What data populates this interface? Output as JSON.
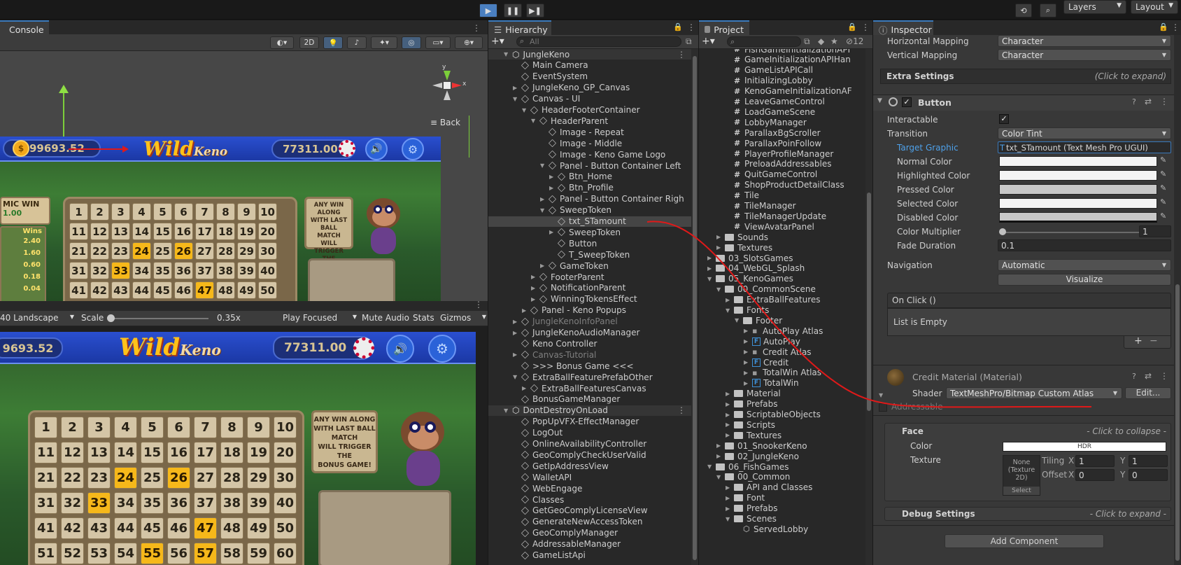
{
  "toolbar_top": {
    "layers_label": "Layers",
    "layout_label": "Layout"
  },
  "console": {
    "tab_label": "Console"
  },
  "scene": {
    "mode_2d": "2D",
    "back_label": "Back",
    "gizmo_axis_x": "x",
    "gizmo_axis_y": "y"
  },
  "game_toolbar": {
    "aspect": "40 Landscape",
    "scale_label": "Scale",
    "scale_value": "0.35x",
    "play_focused": "Play Focused",
    "mute_audio": "Mute Audio",
    "stats": "Stats",
    "gizmos": "Gizmos"
  },
  "game": {
    "balance_top": "99693.52",
    "balance_bottom": "9693.52",
    "credits": "77311.00",
    "logo_main": "Wild",
    "logo_sub": "Keno",
    "cosmic_win_label": "MIC WIN",
    "cosmic_win_value": "1.00",
    "wins_label": "Wins",
    "wins_values": [
      "2.40",
      "1.60",
      "0.60",
      "0.18",
      "0.04"
    ],
    "bonus_note": [
      "ANY WIN ALONG",
      "WITH LAST BALL",
      "MATCH",
      "WILL TRIGGER",
      "THE",
      "BONUS GAME!"
    ],
    "hit_numbers": [
      24,
      26,
      33,
      47,
      55,
      57
    ]
  },
  "hierarchy": {
    "tab_label": "Hierarchy",
    "search_placeholder": "All",
    "rows": [
      {
        "label": "JungleKeno",
        "indent": 0,
        "tri": "▼",
        "icon": "unity",
        "kebab": true,
        "dim": false,
        "sel": false
      },
      {
        "label": "Main Camera",
        "indent": 1,
        "tri": "",
        "icon": "cube",
        "dim": false,
        "sel": false
      },
      {
        "label": "EventSystem",
        "indent": 1,
        "tri": "",
        "icon": "cube",
        "dim": false,
        "sel": false
      },
      {
        "label": "JungleKeno_GP_Canvas",
        "indent": 1,
        "tri": "▶",
        "icon": "cube",
        "dim": false,
        "sel": false
      },
      {
        "label": "Canvas - UI",
        "indent": 1,
        "tri": "▼",
        "icon": "cube",
        "dim": false,
        "sel": false
      },
      {
        "label": "HeaderFooterContainer",
        "indent": 2,
        "tri": "▼",
        "icon": "cube",
        "dim": false,
        "sel": false
      },
      {
        "label": "HeaderParent",
        "indent": 3,
        "tri": "▼",
        "icon": "cube",
        "dim": false,
        "sel": false
      },
      {
        "label": "Image - Repeat",
        "indent": 4,
        "tri": "",
        "icon": "cube",
        "dim": false,
        "sel": false
      },
      {
        "label": "Image - Middle",
        "indent": 4,
        "tri": "",
        "icon": "cube",
        "dim": false,
        "sel": false
      },
      {
        "label": "Image - Keno Game Logo",
        "indent": 4,
        "tri": "",
        "icon": "cube",
        "dim": false,
        "sel": false
      },
      {
        "label": "Panel - Button Container Left",
        "indent": 4,
        "tri": "▼",
        "icon": "cube",
        "dim": false,
        "sel": false
      },
      {
        "label": "Btn_Home",
        "indent": 5,
        "tri": "▶",
        "icon": "cube",
        "dim": false,
        "sel": false
      },
      {
        "label": "Btn_Profile",
        "indent": 5,
        "tri": "▶",
        "icon": "cube",
        "dim": false,
        "sel": false
      },
      {
        "label": "Panel - Button Container Righ",
        "indent": 4,
        "tri": "▶",
        "icon": "cube",
        "dim": false,
        "sel": false
      },
      {
        "label": "SweepToken",
        "indent": 4,
        "tri": "▼",
        "icon": "cube",
        "dim": false,
        "sel": false
      },
      {
        "label": "txt_STamount",
        "indent": 5,
        "tri": "",
        "icon": "cube",
        "dim": false,
        "sel": true
      },
      {
        "label": "SweepToken",
        "indent": 5,
        "tri": "▶",
        "icon": "cube",
        "dim": false,
        "sel": false
      },
      {
        "label": "Button",
        "indent": 5,
        "tri": "",
        "icon": "cube",
        "dim": false,
        "sel": false
      },
      {
        "label": "T_SweepToken",
        "indent": 5,
        "tri": "",
        "icon": "cube",
        "dim": false,
        "sel": false
      },
      {
        "label": "GameToken",
        "indent": 4,
        "tri": "▶",
        "icon": "cube",
        "dim": false,
        "sel": false
      },
      {
        "label": "FooterParent",
        "indent": 3,
        "tri": "▶",
        "icon": "cube",
        "dim": false,
        "sel": false
      },
      {
        "label": "NotificationParent",
        "indent": 3,
        "tri": "▶",
        "icon": "cube",
        "dim": false,
        "sel": false
      },
      {
        "label": "WinningTokensEffect",
        "indent": 3,
        "tri": "▶",
        "icon": "cube",
        "dim": false,
        "sel": false
      },
      {
        "label": "Panel - Keno Popups",
        "indent": 2,
        "tri": "▶",
        "icon": "cube",
        "dim": false,
        "sel": false
      },
      {
        "label": "JungleKenoInfoPanel",
        "indent": 1,
        "tri": "▶",
        "icon": "cube",
        "dim": true,
        "sel": false
      },
      {
        "label": "JungleKenoAudioManager",
        "indent": 1,
        "tri": "▶",
        "icon": "cube",
        "dim": false,
        "sel": false
      },
      {
        "label": "Keno Controller",
        "indent": 1,
        "tri": "",
        "icon": "cube",
        "dim": false,
        "sel": false
      },
      {
        "label": "Canvas-Tutorial",
        "indent": 1,
        "tri": "▶",
        "icon": "cube",
        "dim": true,
        "sel": false
      },
      {
        "label": ">>> Bonus Game <<<",
        "indent": 1,
        "tri": "",
        "icon": "cube",
        "dim": false,
        "sel": false
      },
      {
        "label": "ExtraBallFeaturePrefabOther",
        "indent": 1,
        "tri": "▼",
        "icon": "cube",
        "dim": false,
        "sel": false
      },
      {
        "label": "ExtraBallFeaturesCanvas",
        "indent": 2,
        "tri": "▶",
        "icon": "cube",
        "dim": false,
        "sel": false
      },
      {
        "label": "BonusGameManager",
        "indent": 1,
        "tri": "",
        "icon": "cube",
        "dim": false,
        "sel": false
      },
      {
        "label": "DontDestroyOnLoad",
        "indent": 0,
        "tri": "▼",
        "icon": "unity",
        "kebab": true,
        "dim": false,
        "sel": false
      },
      {
        "label": "PopUpVFX-EffectManager",
        "indent": 1,
        "tri": "",
        "icon": "cube",
        "dim": false,
        "sel": false
      },
      {
        "label": "LogOut",
        "indent": 1,
        "tri": "",
        "icon": "cube",
        "dim": false,
        "sel": false
      },
      {
        "label": "OnlineAvailabilityController",
        "indent": 1,
        "tri": "",
        "icon": "cube",
        "dim": false,
        "sel": false
      },
      {
        "label": "GeoComplyCheckUserValid",
        "indent": 1,
        "tri": "",
        "icon": "cube",
        "dim": false,
        "sel": false
      },
      {
        "label": "GetIpAddressView",
        "indent": 1,
        "tri": "",
        "icon": "cube",
        "dim": false,
        "sel": false
      },
      {
        "label": "WalletAPI",
        "indent": 1,
        "tri": "",
        "icon": "cube",
        "dim": false,
        "sel": false
      },
      {
        "label": "WebEngage",
        "indent": 1,
        "tri": "",
        "icon": "cube",
        "dim": false,
        "sel": false
      },
      {
        "label": "Classes",
        "indent": 1,
        "tri": "",
        "icon": "cube",
        "dim": false,
        "sel": false
      },
      {
        "label": "GetGeoComplyLicenseView",
        "indent": 1,
        "tri": "",
        "icon": "cube",
        "dim": false,
        "sel": false
      },
      {
        "label": "GenerateNewAccessToken",
        "indent": 1,
        "tri": "",
        "icon": "cube",
        "dim": false,
        "sel": false
      },
      {
        "label": "GeoComplyManager",
        "indent": 1,
        "tri": "",
        "icon": "cube",
        "dim": false,
        "sel": false
      },
      {
        "label": "AddressableManager",
        "indent": 1,
        "tri": "",
        "icon": "cube",
        "dim": false,
        "sel": false
      },
      {
        "label": "GameListApi",
        "indent": 1,
        "tri": "",
        "icon": "cube",
        "dim": false,
        "sel": false
      }
    ]
  },
  "project": {
    "tab_label": "Project",
    "hidden_count": "12",
    "rows": [
      {
        "label": "FishGameInitializationAPI",
        "indent": 4,
        "tri": "",
        "icon": "script"
      },
      {
        "label": "GameInitializationAPIHan",
        "indent": 4,
        "tri": "",
        "icon": "script"
      },
      {
        "label": "GameListAPICall",
        "indent": 4,
        "tri": "",
        "icon": "script"
      },
      {
        "label": "InitializingLobby",
        "indent": 4,
        "tri": "",
        "icon": "script"
      },
      {
        "label": "KenoGameInitializationAF",
        "indent": 4,
        "tri": "",
        "icon": "script"
      },
      {
        "label": "LeaveGameControl",
        "indent": 4,
        "tri": "",
        "icon": "script"
      },
      {
        "label": "LoadGameScene",
        "indent": 4,
        "tri": "",
        "icon": "script"
      },
      {
        "label": "LobbyManager",
        "indent": 4,
        "tri": "",
        "icon": "script"
      },
      {
        "label": "ParallaxBgScroller",
        "indent": 4,
        "tri": "",
        "icon": "script"
      },
      {
        "label": "ParallaxPoinFollow",
        "indent": 4,
        "tri": "",
        "icon": "script"
      },
      {
        "label": "PlayerProfileManager",
        "indent": 4,
        "tri": "",
        "icon": "script"
      },
      {
        "label": "PreloadAddressables",
        "indent": 4,
        "tri": "",
        "icon": "script"
      },
      {
        "label": "QuitGameControl",
        "indent": 4,
        "tri": "",
        "icon": "script"
      },
      {
        "label": "ShopProductDetailClass",
        "indent": 4,
        "tri": "",
        "icon": "script"
      },
      {
        "label": "Tile",
        "indent": 4,
        "tri": "",
        "icon": "script"
      },
      {
        "label": "TileManager",
        "indent": 4,
        "tri": "",
        "icon": "script"
      },
      {
        "label": "TileManagerUpdate",
        "indent": 4,
        "tri": "",
        "icon": "script"
      },
      {
        "label": "ViewAvatarPanel",
        "indent": 4,
        "tri": "",
        "icon": "script"
      },
      {
        "label": "Sounds",
        "indent": 3,
        "tri": "▶",
        "icon": "folder"
      },
      {
        "label": "Textures",
        "indent": 3,
        "tri": "▶",
        "icon": "folder"
      },
      {
        "label": "03_SlotsGames",
        "indent": 2,
        "tri": "▶",
        "icon": "folder"
      },
      {
        "label": "04_WebGL_Splash",
        "indent": 2,
        "tri": "▶",
        "icon": "folder"
      },
      {
        "label": "05_KenoGames",
        "indent": 2,
        "tri": "▼",
        "icon": "folder"
      },
      {
        "label": "00_CommonScene",
        "indent": 3,
        "tri": "▼",
        "icon": "folder"
      },
      {
        "label": "ExtraBallFeatures",
        "indent": 4,
        "tri": "▶",
        "icon": "folder"
      },
      {
        "label": "Fonts",
        "indent": 4,
        "tri": "▼",
        "icon": "folder"
      },
      {
        "label": "Footer",
        "indent": 5,
        "tri": "▼",
        "icon": "folder"
      },
      {
        "label": "AutoPlay Atlas",
        "indent": 6,
        "tri": "▶",
        "icon": "atlas"
      },
      {
        "label": "AutoPlay",
        "indent": 6,
        "tri": "▶",
        "icon": "font"
      },
      {
        "label": "Credit Atlas",
        "indent": 6,
        "tri": "▶",
        "icon": "atlas"
      },
      {
        "label": "Credit",
        "indent": 6,
        "tri": "▶",
        "icon": "font"
      },
      {
        "label": "TotalWin Atlas",
        "indent": 6,
        "tri": "▶",
        "icon": "atlas"
      },
      {
        "label": "TotalWin",
        "indent": 6,
        "tri": "▶",
        "icon": "font"
      },
      {
        "label": "Material",
        "indent": 4,
        "tri": "▶",
        "icon": "folder"
      },
      {
        "label": "Prefabs",
        "indent": 4,
        "tri": "▶",
        "icon": "folder"
      },
      {
        "label": "ScriptableObjects",
        "indent": 4,
        "tri": "▶",
        "icon": "folder"
      },
      {
        "label": "Scripts",
        "indent": 4,
        "tri": "▶",
        "icon": "folder"
      },
      {
        "label": "Textures",
        "indent": 4,
        "tri": "▶",
        "icon": "folder"
      },
      {
        "label": "01_SnookerKeno",
        "indent": 3,
        "tri": "▶",
        "icon": "folder"
      },
      {
        "label": "02_JungleKeno",
        "indent": 3,
        "tri": "▶",
        "icon": "folder"
      },
      {
        "label": "06_FishGames",
        "indent": 2,
        "tri": "▼",
        "icon": "folder"
      },
      {
        "label": "00_Common",
        "indent": 3,
        "tri": "▼",
        "icon": "folder"
      },
      {
        "label": "API and Classes",
        "indent": 4,
        "tri": "▶",
        "icon": "folder"
      },
      {
        "label": "Font",
        "indent": 4,
        "tri": "▶",
        "icon": "folder"
      },
      {
        "label": "Prefabs",
        "indent": 4,
        "tri": "▶",
        "icon": "folder"
      },
      {
        "label": "Scenes",
        "indent": 4,
        "tri": "▼",
        "icon": "folder"
      },
      {
        "label": "ServedLobby",
        "indent": 5,
        "tri": "",
        "icon": "scene"
      }
    ]
  },
  "inspector": {
    "tab_label": "Inspector",
    "horizontal_mapping_label": "Horizontal Mapping",
    "horizontal_mapping_value": "Character",
    "vertical_mapping_label": "Vertical Mapping",
    "vertical_mapping_value": "Character",
    "extra_settings_label": "Extra Settings",
    "click_to_expand": "(Click to expand)",
    "button_component": "Button",
    "interactable_label": "Interactable",
    "transition_label": "Transition",
    "transition_value": "Color Tint",
    "target_graphic_label": "Target Graphic",
    "target_graphic_value": "txt_STamount (Text Mesh Pro UGUI)",
    "normal_color_label": "Normal Color",
    "highlighted_color_label": "Highlighted Color",
    "pressed_color_label": "Pressed Color",
    "selected_color_label": "Selected Color",
    "disabled_color_label": "Disabled Color",
    "color_multiplier_label": "Color Multiplier",
    "color_multiplier_value": "1",
    "fade_duration_label": "Fade Duration",
    "fade_duration_value": "0.1",
    "navigation_label": "Navigation",
    "navigation_value": "Automatic",
    "visualize_label": "Visualize",
    "onclick_label": "On Click ()",
    "list_empty": "List is Empty",
    "material_label": "Credit Material (Material)",
    "shader_label": "Shader",
    "shader_value": "TextMeshPro/Bitmap Custom Atlas",
    "edit_label": "Edit...",
    "addressable_label": "Addressable",
    "face_label": "Face",
    "click_to_collapse": "- Click to collapse -",
    "color_label": "Color",
    "hdr_label": "HDR",
    "texture_label": "Texture",
    "texture_none": "None (Texture 2D)",
    "select_label": "Select",
    "tiling_label": "Tiling",
    "offset_label": "Offset",
    "x_label": "X",
    "y_label": "Y",
    "tiling_x": "1",
    "tiling_y": "1",
    "offset_x": "0",
    "offset_y": "0",
    "debug_settings_label": "Debug Settings",
    "click_to_expand2": "- Click to expand -",
    "add_component_label": "Add Component"
  },
  "colors": {
    "accent": "#3a79bb",
    "annotation": "#e01919",
    "hit_cell": "#f6b81a",
    "link_blue": "#4ea1ea"
  }
}
